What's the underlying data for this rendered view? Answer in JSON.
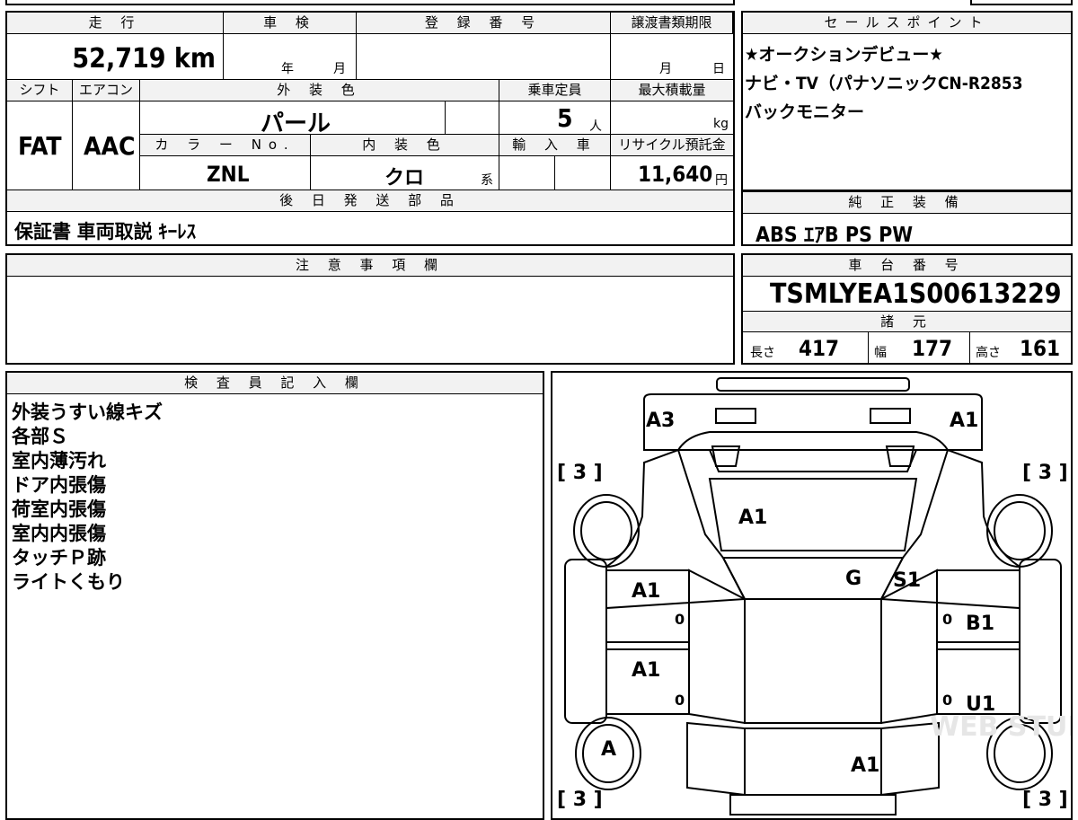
{
  "labels": {
    "mileage": "走 行",
    "inspection": "車 検",
    "registration": "登 録 番 号",
    "transfer_deadline": "譲渡書類期限",
    "sales_points": "セールスポイント",
    "shift": "シフト",
    "aircon": "エアコン",
    "exterior_color": "外 装 色",
    "capacity": "乗車定員",
    "max_load": "最大積載量",
    "color_no": "カ ラ ー No.",
    "interior_color": "内 装 色",
    "import": "輸 入 車",
    "recycle": "リサイクル預託金",
    "deferred_parts": "後 日 発 送 部 品",
    "genuine_equipment": "純 正 装 備",
    "notes": "注 意 事 項 欄",
    "chassis_no": "車 台 番 号",
    "specs": "諸 元",
    "inspector": "検 査 員 記 入 欄"
  },
  "vehicle": {
    "mileage": "52,719 km",
    "inspection_year": "年",
    "inspection_month": "月",
    "transfer_month": "月",
    "transfer_day": "日",
    "shift": "FAT",
    "aircon": "AAC",
    "exterior_color": "パール",
    "capacity": "5",
    "capacity_unit": "人",
    "max_load_unit": "kg",
    "color_no": "ZNL",
    "interior_color": "クロ",
    "interior_suffix": "系",
    "recycle_fee": "11,640",
    "recycle_unit": "円",
    "deferred_parts": "保証書 車両取説 ｷｰﾚｽ",
    "genuine_equipment": "ABS ｴｱB PS PW",
    "chassis_no": "TSMLYEA1S00613229",
    "length_label": "長さ",
    "length": "417",
    "width_label": "幅",
    "width": "177",
    "height_label": "高さ",
    "height": "161"
  },
  "sales_points": [
    "★オークションデビュー★",
    "ナビ・TV（パナソニックCN-R2853",
    "バックモニター"
  ],
  "inspector_notes": [
    "外装うすい線キズ",
    "各部Ｓ",
    "室内薄汚れ",
    "ドア内張傷",
    "荷室内張傷",
    "室内内張傷",
    "タッチＰ跡",
    "ライトくもり"
  ],
  "diagram": {
    "tread_fl": "[ 3 ]",
    "tread_fr": "[ 3 ]",
    "tread_rl": "[ 3 ]",
    "tread_rr": "[ 3 ]",
    "bumper_left": "A3",
    "bumper_right": "A1",
    "hood": "A1",
    "windshield": "G",
    "pillar": "S1",
    "front_left_door": "A1",
    "rear_left_door": "A1",
    "front_right_door_extra": "B1",
    "rear_right_door": "U1",
    "left_rear_wheel": "A",
    "rear": "A1",
    "zero_1": "0",
    "zero_2": "0",
    "zero_3": "0",
    "zero_4": "0",
    "watermark": "WEB STUDIO PRO"
  }
}
